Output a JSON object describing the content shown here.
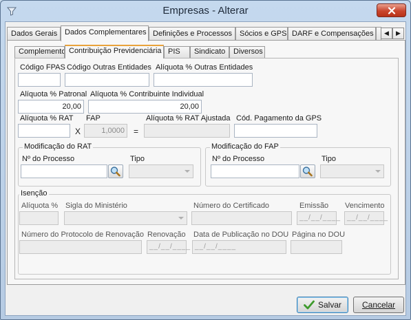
{
  "window": {
    "title": "Empresas - Alterar"
  },
  "outer_tabs": [
    {
      "label": "Dados Gerais"
    },
    {
      "label": "Dados Complementares"
    },
    {
      "label": "Definições e Processos"
    },
    {
      "label": "Sócios e GPS"
    },
    {
      "label": "DARF e Compensações"
    },
    {
      "label": ""
    }
  ],
  "inner_tabs": [
    {
      "label": "Complemento"
    },
    {
      "label": "Contribuição Previdenciária"
    },
    {
      "label": "PIS"
    },
    {
      "label": "Sindicato"
    },
    {
      "label": "Diversos"
    }
  ],
  "form": {
    "codigo_fpas_label": "Código FPAS",
    "codigo_outras_label": "Código Outras Entidades",
    "aliquota_outras_label": "Alíquota % Outras Entidades",
    "aliquota_patronal_label": "Alíquota % Patronal",
    "aliquota_patronal_value": "20,00",
    "aliquota_contribuinte_label": "Alíquota % Contribuinte Individual",
    "aliquota_contribuinte_value": "20,00",
    "aliquota_rat_label": "Alíquota % RAT",
    "fap_label": "FAP",
    "fap_value": "1,0000",
    "multiply_symbol": "X",
    "equals_symbol": "=",
    "rat_ajustada_label": "Alíquota % RAT Ajustada",
    "cod_pagamento_label": "Cód. Pagamento da GPS"
  },
  "rat_group": {
    "title": "Modificação do RAT",
    "processo_label": "Nº do Processo",
    "tipo_label": "Tipo"
  },
  "fap_group": {
    "title": "Modificação do FAP",
    "processo_label": "Nº do Processo",
    "tipo_label": "Tipo"
  },
  "isencao": {
    "title": "Isenção",
    "aliquota_label": "Alíquota %",
    "sigla_label": "Sigla do Ministério",
    "certificado_label": "Número do Certificado",
    "emissao_label": "Emissão",
    "emissao_value": "__/__/____",
    "vencimento_label": "Vencimento",
    "vencimento_value": "__/__/____",
    "protocolo_label": "Número do Protocolo de Renovação",
    "renovacao_label": "Renovação",
    "renovacao_value": "__/__/____",
    "publicacao_label": "Data de Publicação no DOU",
    "publicacao_value": "__/__/____",
    "pagina_label": "Página no DOU"
  },
  "buttons": {
    "salvar": "Salvar",
    "cancelar": "Cancelar"
  },
  "colors": {
    "accent_tab": "#e9a23b",
    "close_button": "#c9462e"
  }
}
